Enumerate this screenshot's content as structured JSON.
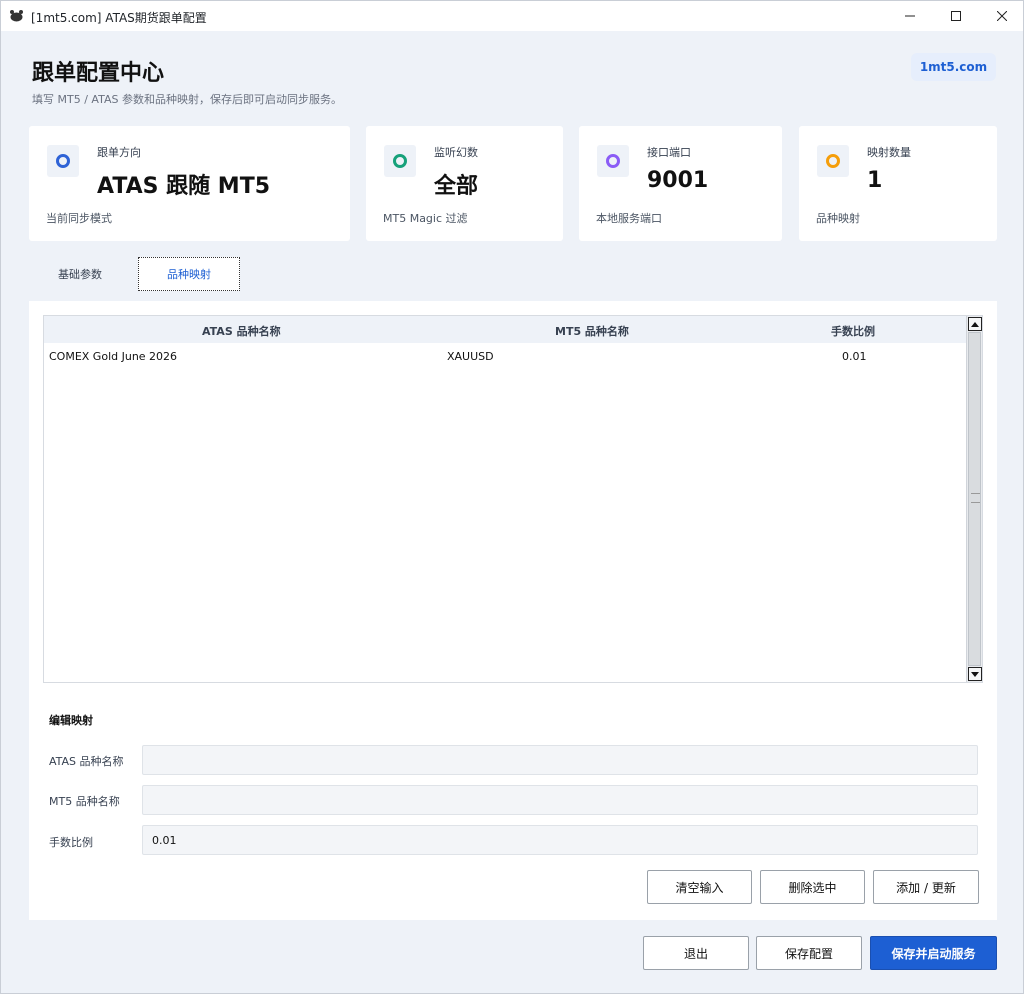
{
  "window": {
    "title": "[1mt5.com] ATAS期货跟单配置",
    "icon": "bear-paw-icon"
  },
  "header": {
    "title": "跟单配置中心",
    "subtitle": "填写 MT5 / ATAS 参数和品种映射，保存后即可启动同步服务。",
    "brand": "1mt5.com"
  },
  "cards": [
    {
      "label": "跟单方向",
      "value": "ATAS 跟随 MT5",
      "caption": "当前同步模式",
      "color": "#2f63d6"
    },
    {
      "label": "监听幻数",
      "value": "全部",
      "caption": "MT5 Magic 过滤",
      "color": "#16a17a"
    },
    {
      "label": "接口端口",
      "value": "9001",
      "caption": "本地服务端口",
      "color": "#8b5cf6"
    },
    {
      "label": "映射数量",
      "value": "1",
      "caption": "品种映射",
      "color": "#f59e0b"
    }
  ],
  "tabs": {
    "base": "基础参数",
    "mapping": "品种映射",
    "active": "mapping"
  },
  "table": {
    "columns": [
      "ATAS 品种名称",
      "MT5 品种名称",
      "手数比例"
    ],
    "rows": [
      [
        "COMEX Gold June 2026",
        "XAUUSD",
        "0.01"
      ]
    ]
  },
  "editor": {
    "title": "编辑映射",
    "atas_label": "ATAS 品种名称",
    "atas_value": "",
    "mt5_label": "MT5 品种名称",
    "mt5_value": "",
    "ratio_label": "手数比例",
    "ratio_value": "0.01"
  },
  "editor_buttons": {
    "clear": "清空输入",
    "delete": "删除选中",
    "add": "添加 / 更新"
  },
  "footer_buttons": {
    "exit": "退出",
    "save": "保存配置",
    "save_start": "保存并启动服务"
  }
}
